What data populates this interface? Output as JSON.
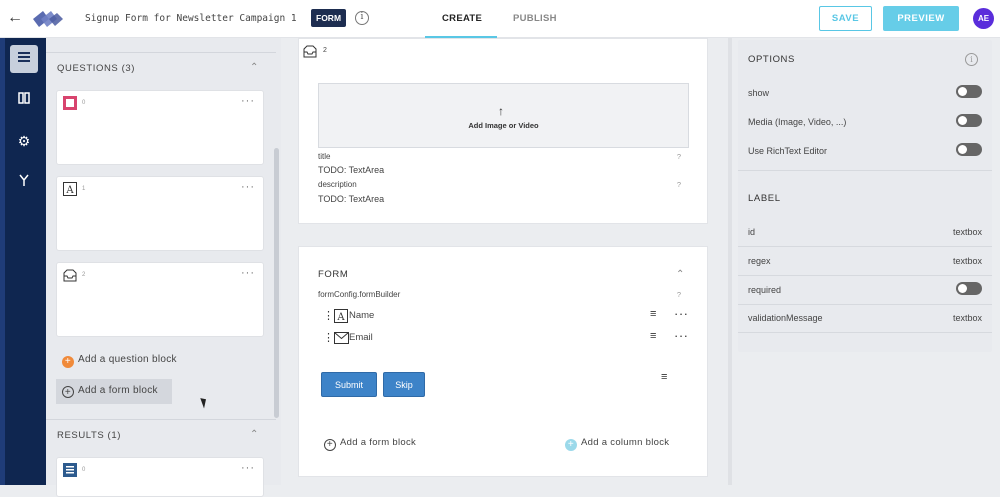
{
  "topbar": {
    "title": "Signup Form for Newsletter Campaign 1",
    "badge": "FORM",
    "info_icon": "i",
    "tabs": [
      {
        "label": "CREATE",
        "active": true
      },
      {
        "label": "PUBLISH",
        "active": false
      }
    ],
    "save_label": "SAVE",
    "preview_label": "PREVIEW",
    "avatar_initials": "AE"
  },
  "rail": {
    "items": [
      {
        "name": "list-icon",
        "glyph": "☰",
        "active": true
      },
      {
        "name": "book-icon",
        "glyph": "▤",
        "active": false
      },
      {
        "name": "gear-icon",
        "glyph": "⚙",
        "active": false
      },
      {
        "name": "branch-icon",
        "glyph": "⑂",
        "active": false
      }
    ]
  },
  "sidebar": {
    "questions_title": "QUESTIONS (3)",
    "questions": [
      {
        "num": "0",
        "icon": "square-icon"
      },
      {
        "num": "1",
        "icon": "text-a-icon"
      },
      {
        "num": "2",
        "icon": "inbox-icon"
      }
    ],
    "add_question": "Add a question block",
    "add_form": "Add a form block",
    "results_title": "RESULTS (1)",
    "results": [
      {
        "num": "0",
        "icon": "list-box-icon"
      }
    ]
  },
  "center": {
    "block_num": "2",
    "media_label": "Add Image or Video",
    "title_label": "title",
    "title_value": "TODO: TextArea",
    "description_label": "description",
    "description_value": "TODO: TextArea",
    "help_mark": "?",
    "form_title": "FORM",
    "builder_label": "formConfig.formBuilder",
    "fields": [
      {
        "label": "Name",
        "icon": "text-a-icon"
      },
      {
        "label": "Email",
        "icon": "mail-icon"
      }
    ],
    "submit_label": "Submit",
    "skip_label": "Skip",
    "add_form_block": "Add a form block",
    "add_column_block": "Add a column block"
  },
  "options": {
    "title": "OPTIONS",
    "rows": [
      {
        "label": "show",
        "toggle": false
      },
      {
        "label": "Media (Image, Video, ...)",
        "toggle": false
      },
      {
        "label": "Use RichText Editor",
        "toggle": false
      }
    ],
    "label_title": "LABEL",
    "label_rows": [
      {
        "label": "id",
        "value": "textbox"
      },
      {
        "label": "regex",
        "value": "textbox"
      },
      {
        "label": "required",
        "toggle": false
      },
      {
        "label": "validationMessage",
        "value": "textbox"
      }
    ]
  },
  "colors": {
    "accent": "#59c7e5",
    "rail": "#0f2650",
    "button_blue": "#3d83c8",
    "avatar": "#5a2ddb"
  }
}
